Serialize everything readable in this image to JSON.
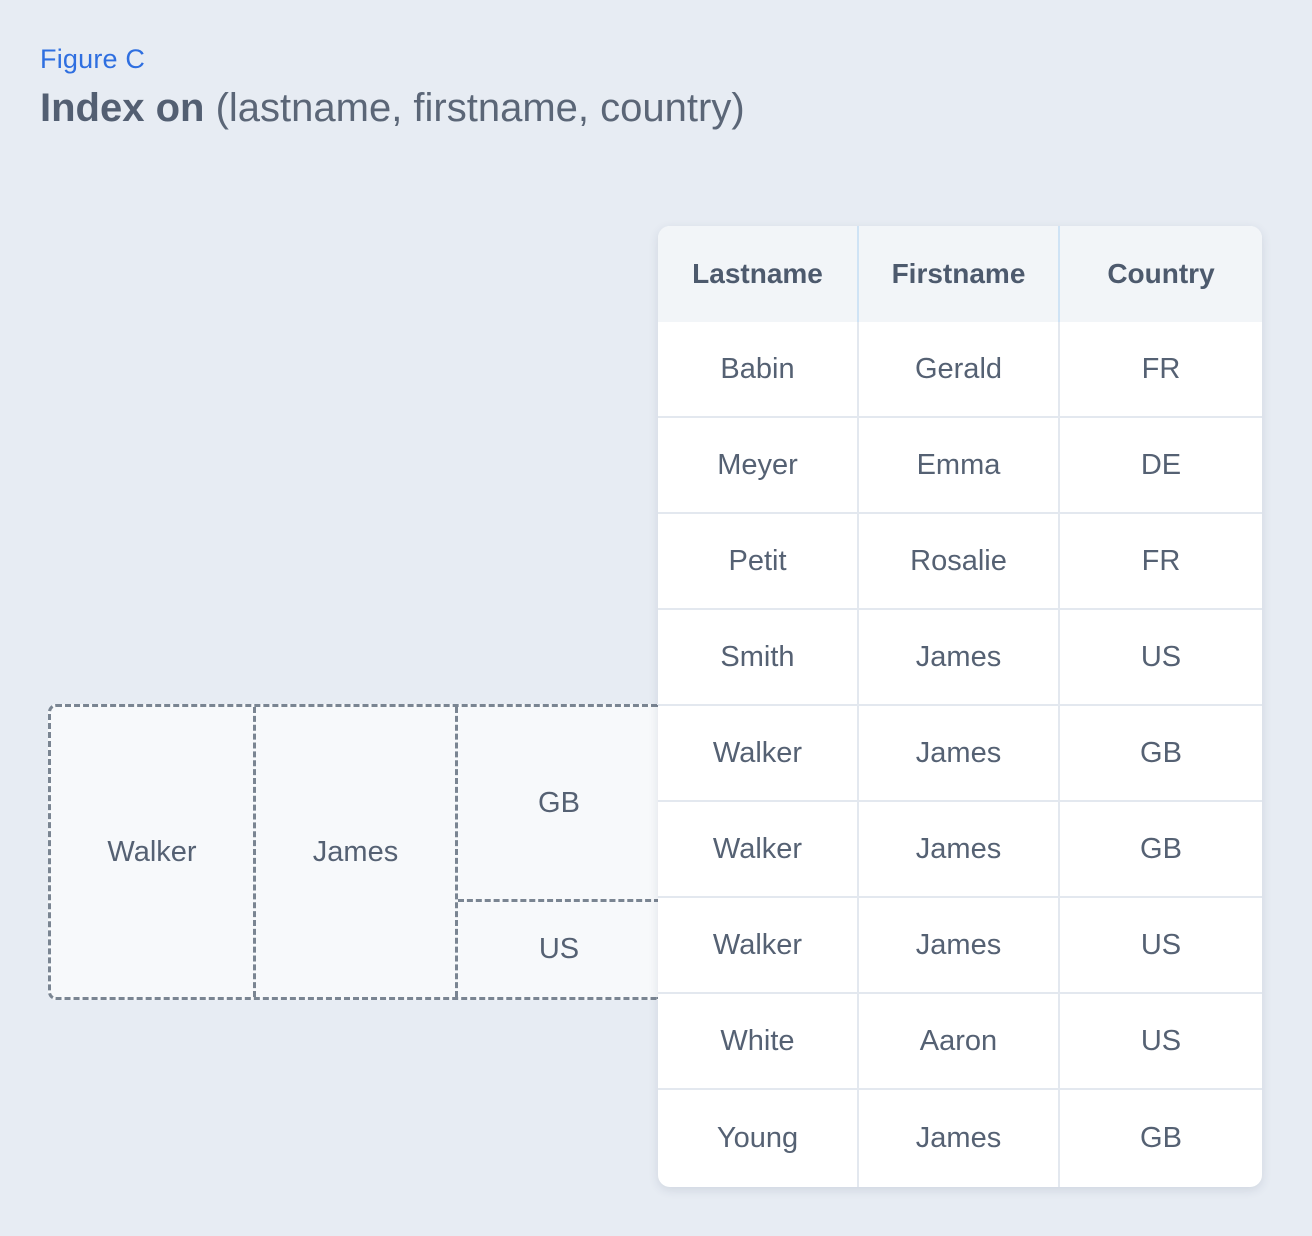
{
  "figure_label": "Figure C",
  "title": {
    "bold": "Index on",
    "rest": "(lastname, firstname, country)"
  },
  "table": {
    "columns": [
      "Lastname",
      "Firstname",
      "Country"
    ],
    "rows": [
      [
        "Babin",
        "Gerald",
        "FR"
      ],
      [
        "Meyer",
        "Emma",
        "DE"
      ],
      [
        "Petit",
        "Rosalie",
        "FR"
      ],
      [
        "Smith",
        "James",
        "US"
      ],
      [
        "Walker",
        "James",
        "GB"
      ],
      [
        "Walker",
        "James",
        "GB"
      ],
      [
        "Walker",
        "James",
        "US"
      ],
      [
        "White",
        "Aaron",
        "US"
      ],
      [
        "Young",
        "James",
        "GB"
      ]
    ]
  },
  "index_entry": {
    "lastname": "Walker",
    "firstname": "James",
    "countries": [
      "GB",
      "US"
    ]
  }
}
